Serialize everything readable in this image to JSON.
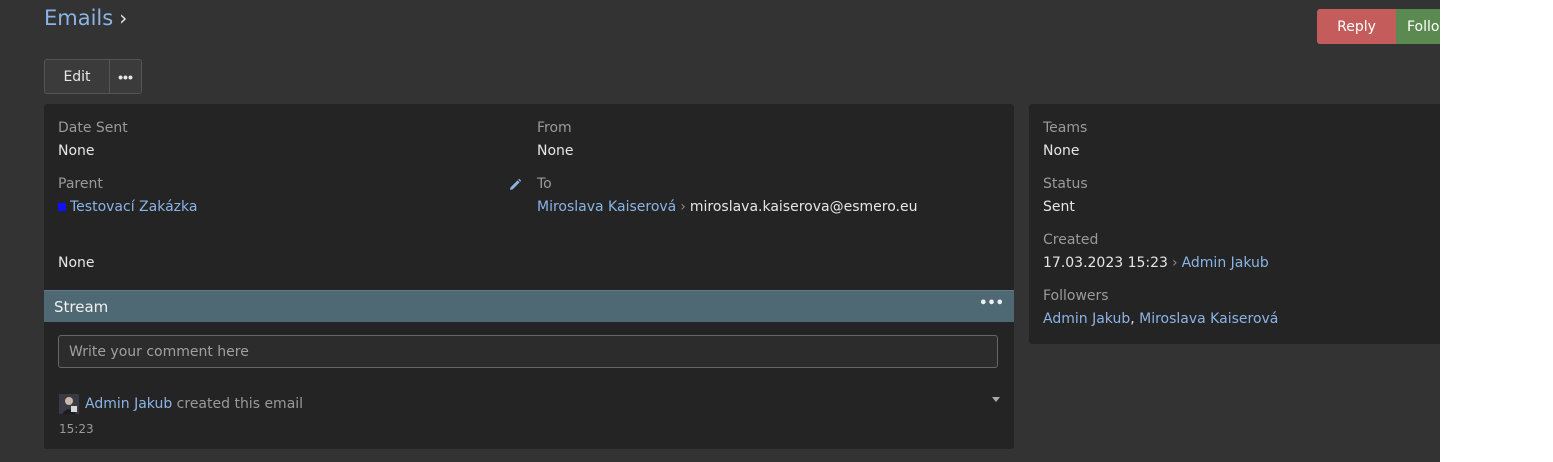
{
  "header": {
    "title": "Emails",
    "separator": "›"
  },
  "actions": {
    "reply_label": "Reply",
    "follow_label": "Follow"
  },
  "toolbar": {
    "edit_label": "Edit",
    "more_label": "•••"
  },
  "record": {
    "date_sent": {
      "label": "Date Sent",
      "value": "None"
    },
    "from": {
      "label": "From",
      "value": "None"
    },
    "parent": {
      "label": "Parent",
      "value": "Testovací Zakázka",
      "dot_color": "#1010ff"
    },
    "to": {
      "label": "To",
      "name": "Miroslava Kaiserová",
      "separator": "›",
      "email": "miroslava.kaiserova@esmero.eu"
    },
    "extra_value": "None"
  },
  "stream": {
    "title": "Stream",
    "menu_label": "•••",
    "comment_placeholder": "Write your comment here",
    "notes": [
      {
        "user": "Admin Jakub",
        "action": "created this email",
        "time": "15:23"
      }
    ]
  },
  "side": {
    "teams": {
      "label": "Teams",
      "value": "None"
    },
    "status": {
      "label": "Status",
      "value": "Sent"
    },
    "created": {
      "label": "Created",
      "datetime": "17.03.2023 15:23",
      "separator": "›",
      "user": "Admin Jakub"
    },
    "followers": {
      "label": "Followers",
      "names": [
        "Admin Jakub",
        "Miroslava Kaiserová"
      ],
      "joiner": ","
    }
  },
  "colors": {
    "reply": "#c45c5c",
    "follow": "#5a8a4f",
    "stream_bar": "#4e6874",
    "link": "#8ab4e6"
  }
}
